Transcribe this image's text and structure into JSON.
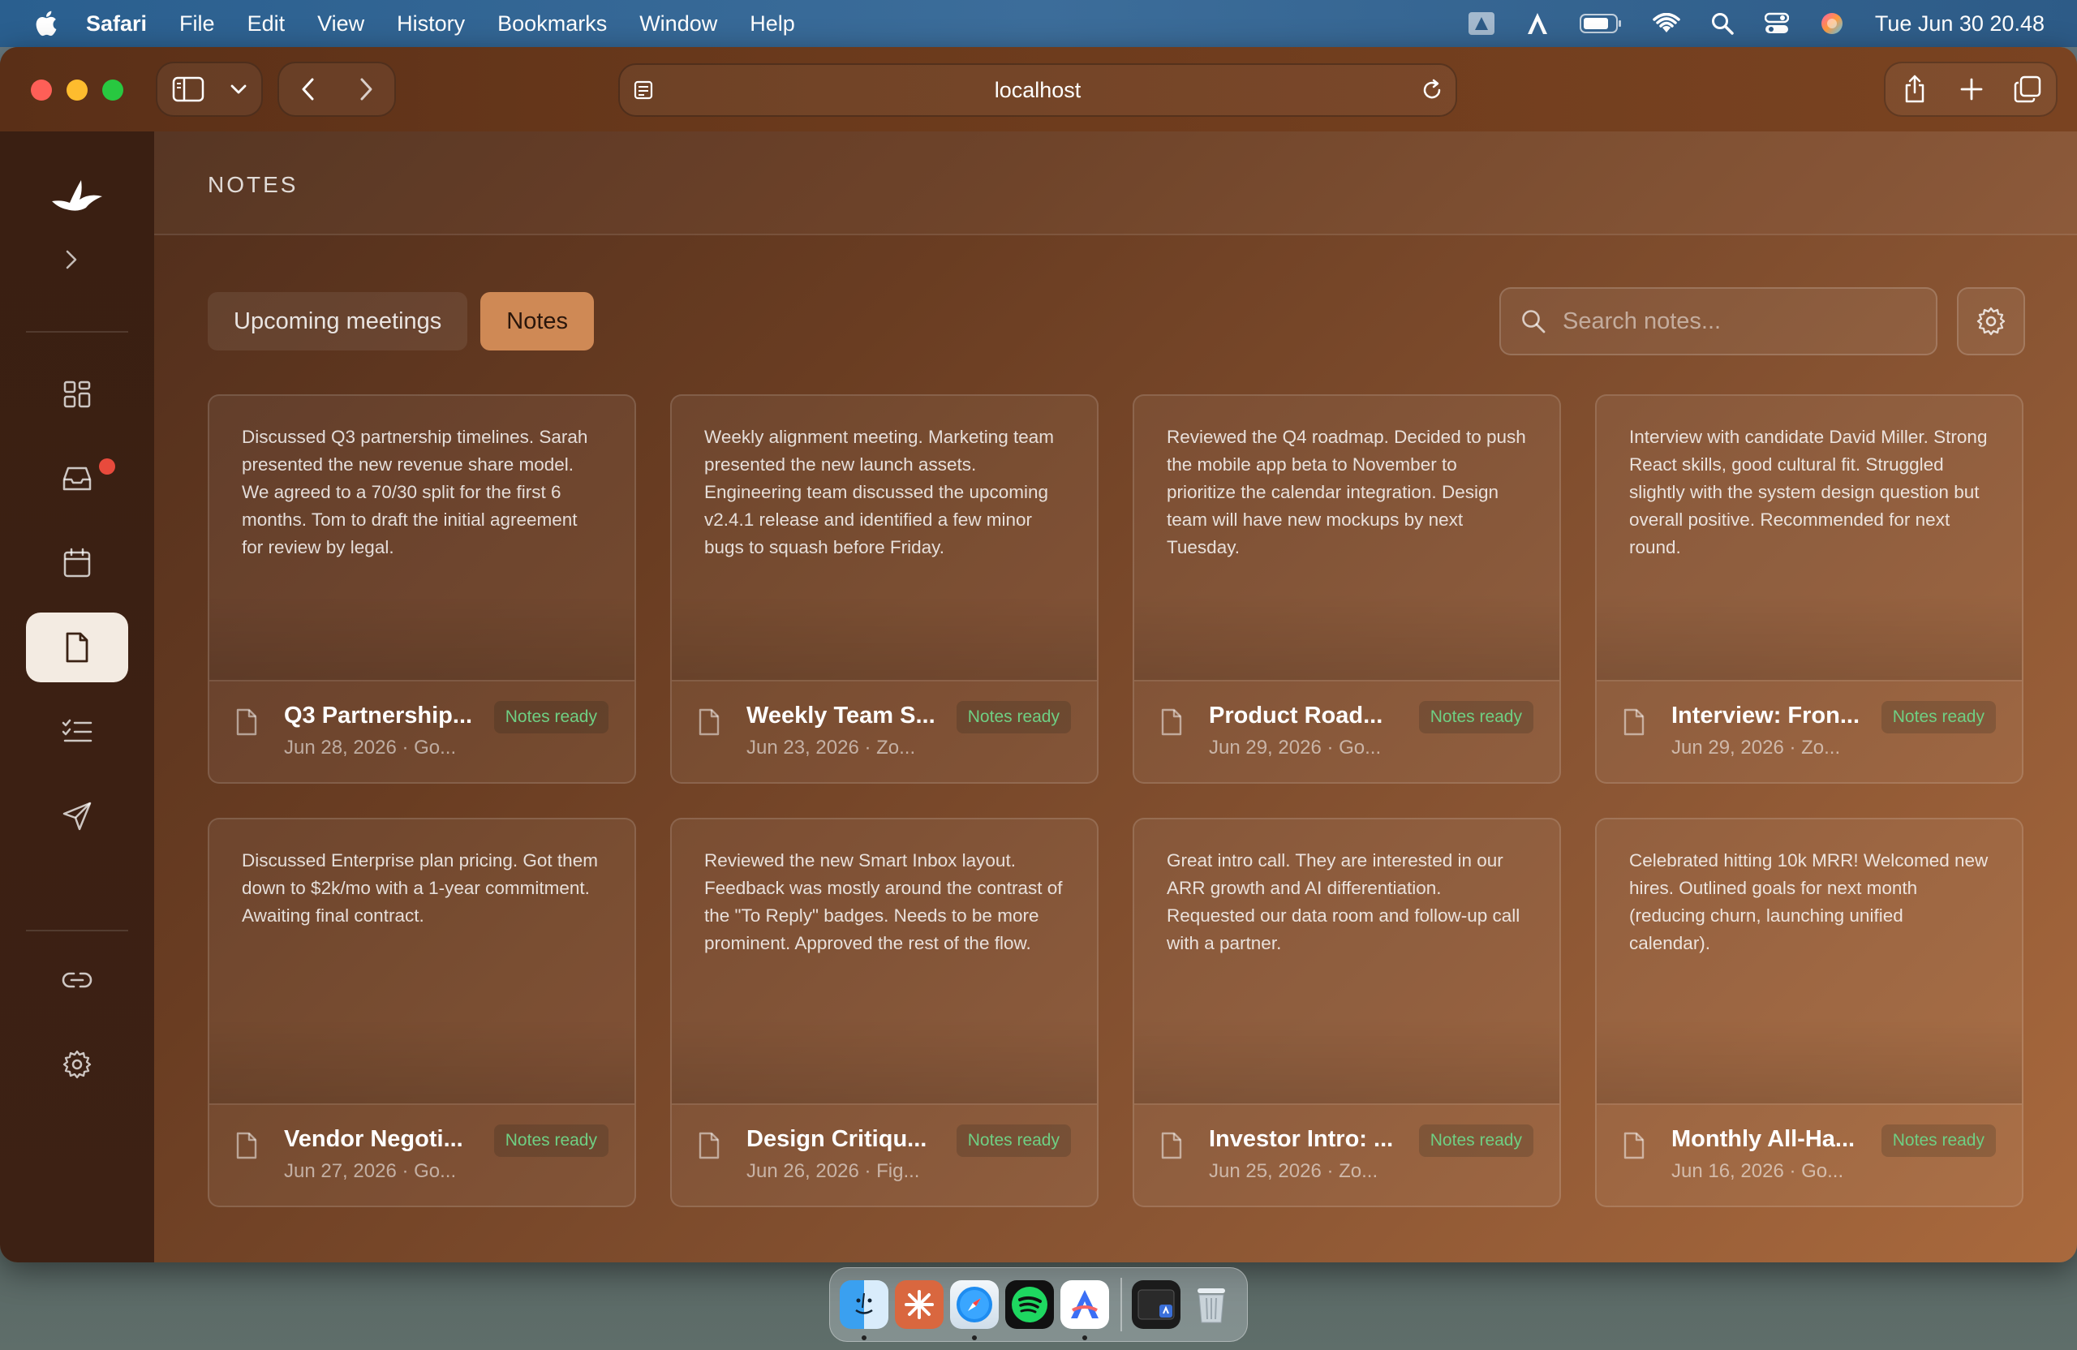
{
  "menubar": {
    "app_name": "Safari",
    "items": [
      "File",
      "Edit",
      "View",
      "History",
      "Bookmarks",
      "Window",
      "Help"
    ],
    "clock": "Tue Jun 30  20.48"
  },
  "browser": {
    "url": "localhost"
  },
  "page": {
    "title": "NOTES",
    "tabs": [
      {
        "label": "Upcoming meetings",
        "active": false
      },
      {
        "label": "Notes",
        "active": true
      }
    ],
    "search_placeholder": "Search notes..."
  },
  "sidebar": {
    "items": [
      {
        "icon": "dashboard-icon"
      },
      {
        "icon": "inbox-icon",
        "notification": true
      },
      {
        "icon": "calendar-icon"
      },
      {
        "icon": "document-icon",
        "active": true
      },
      {
        "icon": "checklist-icon"
      },
      {
        "icon": "send-icon"
      },
      {
        "icon": "link-icon"
      },
      {
        "icon": "settings-icon"
      }
    ]
  },
  "notes": [
    {
      "body": "Discussed Q3 partnership timelines. Sarah presented the new revenue share model. We agreed to a 70/30 split for the first 6 months. Tom to draft the initial agreement for review by legal.",
      "title": "Q3 Partnership...",
      "meta": "Jun 28, 2026 · Go...",
      "badge": "Notes ready"
    },
    {
      "body": "Weekly alignment meeting. Marketing team presented the new launch assets. Engineering team discussed the upcoming v2.4.1 release and identified a few minor bugs to squash before Friday.",
      "title": "Weekly Team S...",
      "meta": "Jun 23, 2026 · Zo...",
      "badge": "Notes ready"
    },
    {
      "body": "Reviewed the Q4 roadmap. Decided to push the mobile app beta to November to prioritize the calendar integration. Design team will have new mockups by next Tuesday.",
      "title": "Product Road...",
      "meta": "Jun 29, 2026 · Go...",
      "badge": "Notes ready"
    },
    {
      "body": "Interview with candidate David Miller. Strong React skills, good cultural fit. Struggled slightly with the system design question but overall positive. Recommended for next round.",
      "title": "Interview: Fron...",
      "meta": "Jun 29, 2026 · Zo...",
      "badge": "Notes ready"
    },
    {
      "body": "Discussed Enterprise plan pricing. Got them down to $2k/mo with a 1-year commitment. Awaiting final contract.",
      "title": "Vendor Negoti...",
      "meta": "Jun 27, 2026 · Go...",
      "badge": "Notes ready"
    },
    {
      "body": "Reviewed the new Smart Inbox layout. Feedback was mostly around the contrast of the \"To Reply\" badges. Needs to be more prominent. Approved the rest of the flow.",
      "title": "Design Critiqu...",
      "meta": "Jun 26, 2026 · Fig...",
      "badge": "Notes ready"
    },
    {
      "body": "Great intro call. They are interested in our ARR growth and AI differentiation. Requested our data room and follow-up call with a partner.",
      "title": "Investor Intro: ...",
      "meta": "Jun 25, 2026 · Zo...",
      "badge": "Notes ready"
    },
    {
      "body": "Celebrated hitting 10k MRR! Welcomed new hires. Outlined goals for next month (reducing churn, launching unified calendar).",
      "title": "Monthly All-Ha...",
      "meta": "Jun 16, 2026 · Go...",
      "badge": "Notes ready"
    }
  ],
  "colors": {
    "accent": "#cf8955",
    "badge_text": "#6fcf83",
    "notification": "#e84a3c"
  },
  "dock": {
    "apps": [
      "finder-icon",
      "claude-icon",
      "safari-icon",
      "spotify-icon",
      "arc-icon",
      "terminal-icon",
      "trash-icon"
    ]
  }
}
